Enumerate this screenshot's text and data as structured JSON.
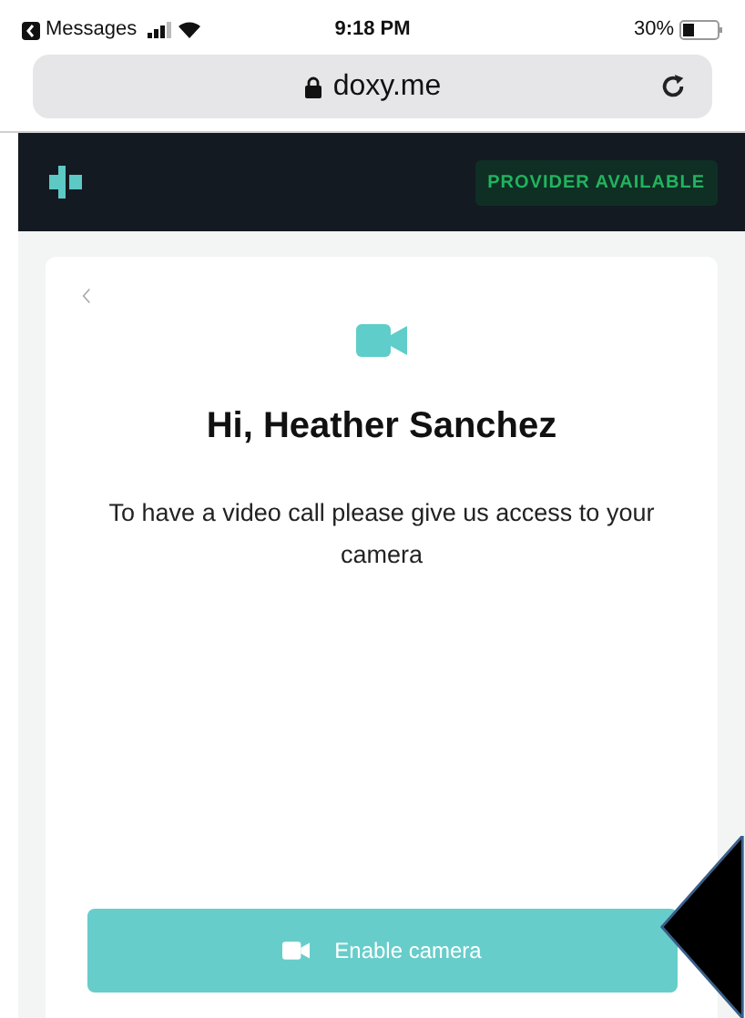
{
  "status_bar": {
    "back_app": "Messages",
    "time": "9:18 PM",
    "battery": "30%"
  },
  "address_bar": {
    "url": "doxy.me"
  },
  "header": {
    "badge": "PROVIDER AVAILABLE"
  },
  "card": {
    "title": "Hi, Heather Sanchez",
    "message": "To have a video call please give us access to your camera",
    "button": "Enable camera"
  }
}
